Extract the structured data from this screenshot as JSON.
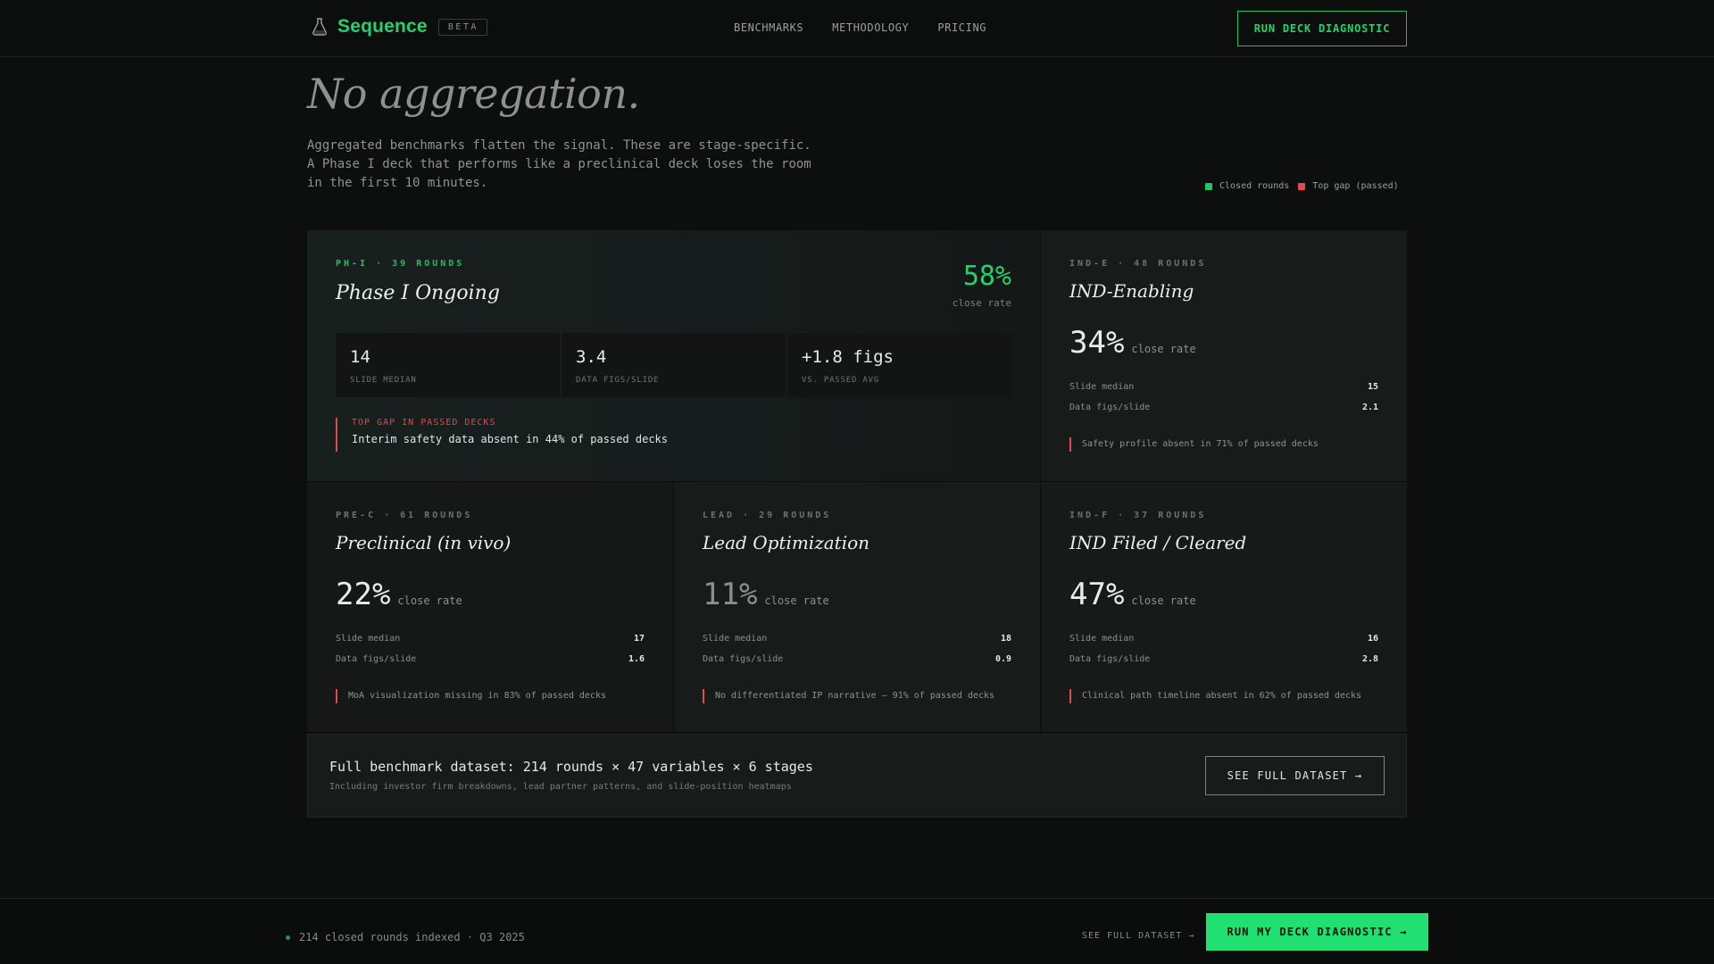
{
  "nav": {
    "brand": "Sequence",
    "badge": "BETA",
    "links": [
      "BENCHMARKS",
      "METHODOLOGY",
      "PRICING"
    ],
    "cta": "RUN DECK DIAGNOSTIC"
  },
  "hero": {
    "title": "No aggregation.",
    "description_lines": [
      "Aggregated benchmarks flatten the signal. These are stage-specific.",
      "A Phase I deck that performs like a preclinical deck loses the room",
      "in the first 10 minutes."
    ]
  },
  "legend": {
    "items": [
      {
        "label": "Closed rounds",
        "color": "#22c55e"
      },
      {
        "label": "Top gap (passed)",
        "color": "#e5484d"
      }
    ]
  },
  "featured": {
    "code": "PH-I · 39 ROUNDS",
    "name": "Phase I Ongoing",
    "rate": "58%",
    "rate_label": "close rate",
    "metrics": [
      {
        "value": "14",
        "label": "SLIDE MEDIAN"
      },
      {
        "value": "3.4",
        "label": "DATA FIGS/SLIDE"
      },
      {
        "value": "+1.8 figs",
        "label": "VS. PASSED AVG"
      }
    ],
    "gap_title": "TOP GAP IN PASSED DECKS",
    "gap_text": "Interim safety data absent in 44% of passed decks"
  },
  "cards": {
    "ind_e": {
      "code": "IND-E · 48 ROUNDS",
      "name": "IND-Enabling",
      "rate": "34%",
      "rate_label": "close rate",
      "slide_median_label": "Slide median",
      "slide_median": "15",
      "figs_label": "Data figs/slide",
      "figs": "2.1",
      "note": "Safety profile absent in 71% of passed decks"
    },
    "prec": {
      "code": "PRE-C · 61 ROUNDS",
      "name": "Preclinical (in vivo)",
      "rate": "22%",
      "rate_label": "close rate",
      "slide_median_label": "Slide median",
      "slide_median": "17",
      "figs_label": "Data figs/slide",
      "figs": "1.6",
      "note": "MoA visualization missing in 83% of passed decks"
    },
    "lead": {
      "code": "LEAD · 29 ROUNDS",
      "name": "Lead Optimization",
      "rate": "11%",
      "rate_label": "close rate",
      "slide_median_label": "Slide median",
      "slide_median": "18",
      "figs_label": "Data figs/slide",
      "figs": "0.9",
      "note": "No differentiated IP narrative — 91% of passed decks"
    },
    "indf": {
      "code": "IND-F · 37 ROUNDS",
      "name": "IND Filed / Cleared",
      "rate": "47%",
      "rate_label": "close rate",
      "slide_median_label": "Slide median",
      "slide_median": "16",
      "figs_label": "Data figs/slide",
      "figs": "2.8",
      "note": "Clinical path timeline absent in 62% of passed decks"
    }
  },
  "dataset": {
    "title": "Full benchmark dataset: 214 rounds × 47 variables × 6 stages",
    "subtitle": "Including investor firm breakdowns, lead partner patterns, and slide-position heatmaps",
    "button": "SEE FULL DATASET →"
  },
  "footer": {
    "status": "214 closed rounds indexed · Q3 2025",
    "link": "SEE FULL DATASET →",
    "cta": "RUN MY DECK DIAGNOSTIC →"
  },
  "colors": {
    "accent": "#22d36b",
    "gap": "#e5484d",
    "background": "#0d0e0e"
  }
}
